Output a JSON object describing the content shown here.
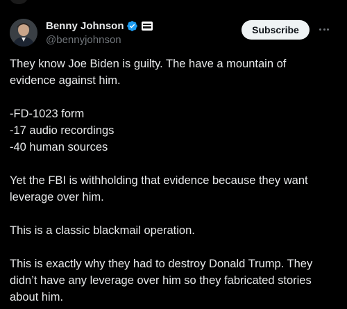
{
  "author": {
    "display_name": "Benny Johnson",
    "handle": "@bennyjohnson"
  },
  "icons": {
    "verified": "verified-badge-icon",
    "affiliate": "affiliate-badge-icon",
    "more": "more-options-icon"
  },
  "colors": {
    "background": "#000000",
    "text": "#e7e9ea",
    "secondary_text": "#71767b",
    "verified": "#1d9bf0",
    "subscribe_bg": "#eff3f4"
  },
  "actions": {
    "subscribe_label": "Subscribe"
  },
  "tweet": {
    "paragraphs": [
      "They know Joe Biden is guilty. The have a mountain of\nevidence against him.",
      "-FD-1023 form\n-17 audio recordings\n-40 human sources",
      "Yet the FBI is withholding that evidence because they want\nleverage over him.",
      "This is a classic blackmail operation.",
      "This is exactly why they had to destroy Donald Trump. They\ndidn’t have any leverage over him so they fabricated stories\nabout him."
    ]
  }
}
